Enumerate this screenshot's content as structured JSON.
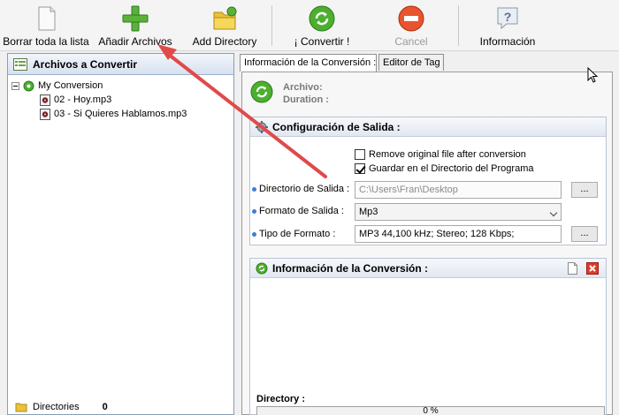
{
  "toolbar": {
    "items": [
      {
        "label": "Borrar toda la lista",
        "icon": "blank-page-icon"
      },
      {
        "label": "Añadir Archivos",
        "icon": "green-plus-icon"
      },
      {
        "label": "Add Directory",
        "icon": "folder-icon"
      },
      {
        "label": "¡ Convertir !",
        "icon": "green-refresh-icon"
      },
      {
        "label": "Cancel",
        "icon": "red-cancel-icon",
        "disabled": true
      },
      {
        "label": "Información",
        "icon": "question-icon"
      }
    ]
  },
  "left_panel": {
    "title": "Archivos a Convertir",
    "tree": {
      "root": "My Conversion",
      "items": [
        "02 - Hoy.mp3",
        "03 - Si Quieres Hablamos.mp3"
      ]
    },
    "footer": {
      "label": "Directories",
      "count": "0"
    }
  },
  "tabs": [
    {
      "label": "Información de la Conversión :",
      "active": true
    },
    {
      "label": "Editor de Tag",
      "active": false
    }
  ],
  "file_info": {
    "archivo_label": "Archivo:",
    "duration_label": "Duration :"
  },
  "output_config": {
    "title": "Configuración de Salida :",
    "remove_original": {
      "label": "Remove original file after conversion",
      "checked": false
    },
    "save_in_program_dir": {
      "label": "Guardar en el Directorio del Programa",
      "checked": true
    },
    "output_dir": {
      "label": "Directorio de Salida :",
      "value": "C:\\Users\\Fran\\Desktop",
      "button": "..."
    },
    "output_format": {
      "label": "Formato de Salida :",
      "value": "Mp3"
    },
    "format_type": {
      "label": "Tipo de Formato :",
      "value": "MP3 44,100 kHz; Stereo;  128 Kbps;",
      "button": "..."
    }
  },
  "conversion_info": {
    "title": "Información de la Conversión :",
    "directory_label": "Directory :",
    "progress_text": "0 %",
    "progress": 0
  },
  "colors": {
    "arrow": "#e04a4a",
    "accent_green": "#4caf2f",
    "panel_border": "#8a9db5"
  }
}
